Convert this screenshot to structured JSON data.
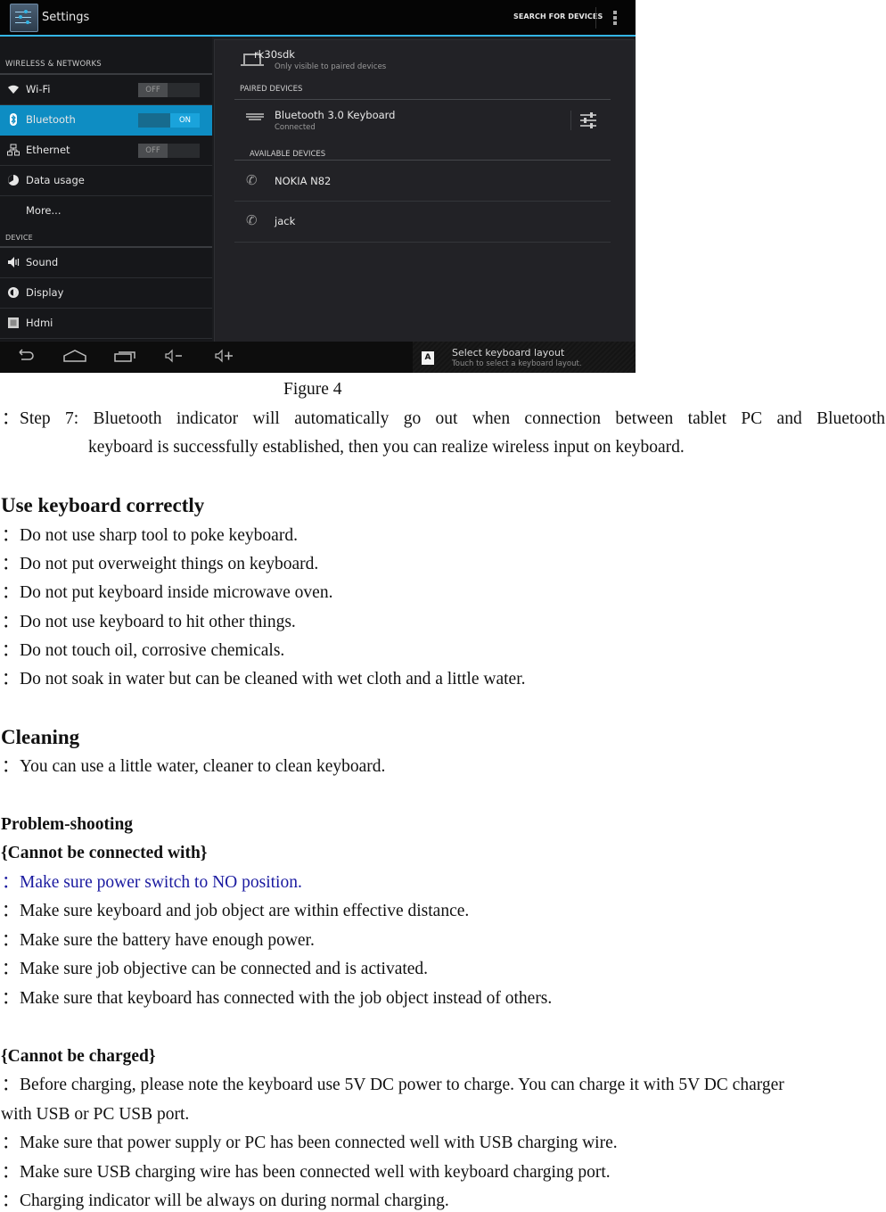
{
  "screenshot": {
    "action_bar": {
      "title": "Settings",
      "search_label": "SEARCH FOR DEVICES",
      "overflow_icon": "overflow-menu-icon"
    },
    "sidebar": {
      "categories": [
        "WIRELESS & NETWORKS",
        "DEVICE"
      ],
      "items": [
        {
          "label": "Wi-Fi",
          "icon": "wifi-icon",
          "toggle": "OFF",
          "active": false
        },
        {
          "label": "Bluetooth",
          "icon": "bluetooth-icon",
          "toggle": "ON",
          "active": true
        },
        {
          "label": "Ethernet",
          "icon": "ethernet-icon",
          "toggle": "OFF",
          "active": false
        },
        {
          "label": "Data usage",
          "icon": "data-usage-icon",
          "active": false
        },
        {
          "label": "More...",
          "active": false
        },
        {
          "label": "Sound",
          "icon": "sound-icon",
          "active": false
        },
        {
          "label": "Display",
          "icon": "display-icon",
          "active": false
        },
        {
          "label": "Hdmi",
          "icon": "hdmi-icon",
          "active": false
        }
      ]
    },
    "content": {
      "this_device": {
        "name": "rk30sdk",
        "subtitle": "Only visible to paired devices"
      },
      "paired_header": "PAIRED DEVICES",
      "paired_devices": [
        {
          "name": "Bluetooth 3.0 Keyboard",
          "status": "Connected"
        }
      ],
      "available_header": "AVAILABLE DEVICES",
      "available_devices": [
        {
          "name": "NOKIA N82"
        },
        {
          "name": "jack"
        }
      ]
    },
    "notification": {
      "title": "Select keyboard layout",
      "subtitle": "Touch to select a keyboard layout.",
      "icon_glyph": "A"
    }
  },
  "document": {
    "caption": "Figure 4",
    "bullet": "：",
    "step7": {
      "line1": "Step 7:   Bluetooth indicator will automatically go out when connection between tablet PC and Bluetooth",
      "line2": "keyboard is successfully established, then you can realize wireless input on keyboard."
    },
    "use_correctly": {
      "heading": "Use keyboard correctly",
      "items": [
        "Do not use sharp tool to poke keyboard.",
        "Do not put overweight things on keyboard.",
        "Do not put keyboard inside microwave oven.",
        "Do not use keyboard to hit other things.",
        "Do not touch oil, corrosive chemicals.",
        "Do not soak in water but can be cleaned with wet cloth and a little water."
      ]
    },
    "cleaning": {
      "heading": "Cleaning",
      "items": [
        "You can use a little water, cleaner to clean keyboard."
      ]
    },
    "problem": {
      "heading": "Problem-shooting",
      "connected_heading": "{Cannot be connected with}",
      "connected_items": [
        "Make sure power switch to NO position.",
        "Make sure keyboard and job object are within effective distance.",
        "Make sure the battery have enough power.",
        "Make sure job objective can be connected and is activated.",
        "Make sure that keyboard has connected with the job object instead of others."
      ],
      "charged_heading": "{Cannot be charged}",
      "charged_first_line1": "Before charging, please note the keyboard use 5V DC power to charge. You can charge it with 5V DC charger",
      "charged_first_line2": "with USB or PC USB port.",
      "charged_items": [
        "Make sure that power supply or PC has been connected well with USB charging wire.",
        "Make sure USB charging wire has been connected well with keyboard charging port.",
        "Charging indicator will be always on during normal charging."
      ]
    }
  }
}
